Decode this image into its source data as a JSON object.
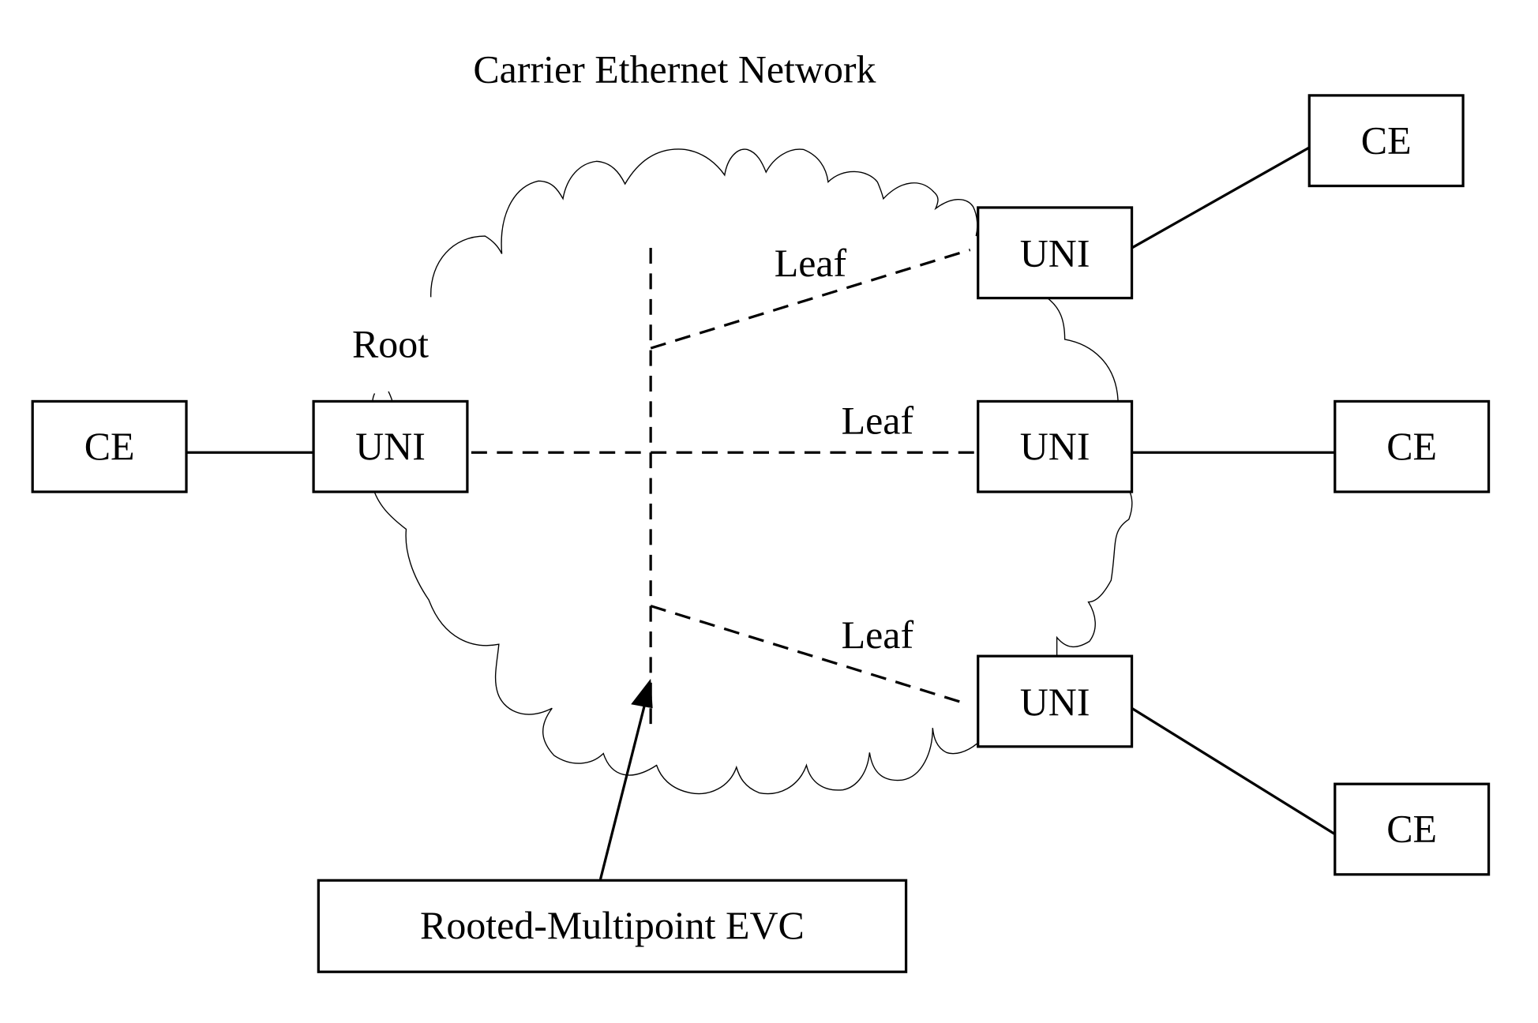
{
  "diagram": {
    "title": "Carrier Ethernet Network",
    "root_label": "Root",
    "leaf_labels": [
      "Leaf",
      "Leaf",
      "Leaf"
    ],
    "root_ce": "CE",
    "root_uni": "UNI",
    "leaf_nodes": [
      {
        "uni": "UNI",
        "ce": "CE"
      },
      {
        "uni": "UNI",
        "ce": "CE"
      },
      {
        "uni": "UNI",
        "ce": "CE"
      }
    ],
    "evc_label": "Rooted-Multipoint EVC",
    "colors": {
      "stroke": "#000000",
      "background": "#ffffff"
    }
  }
}
